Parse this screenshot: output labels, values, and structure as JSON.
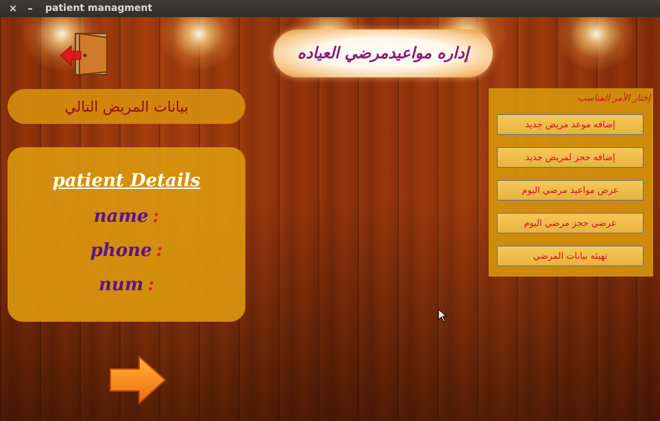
{
  "window": {
    "title": "patient managment",
    "close_glyph": "×",
    "minimize_glyph": "–"
  },
  "header": {
    "title": "إداره مواعيدمرضي العياده"
  },
  "exit": {
    "icon": "exit-door-icon"
  },
  "next_patient": {
    "label": "بيانات المريض التالي"
  },
  "details": {
    "title": "patient Details",
    "fields": [
      {
        "label": "name",
        "separator": ":"
      },
      {
        "label": "phone",
        "separator": ":"
      },
      {
        "label": "num",
        "separator": ":"
      }
    ]
  },
  "next_arrow": {
    "icon": "next-arrow-icon"
  },
  "menu": {
    "label": "إختار الأمر المناسب",
    "buttons": [
      "إضافه موعد مريض جديد",
      "إضافه حجز لمريض جديد",
      "عرض مواعيد مرضي اليوم",
      "عرضي حجز مرضي اليوم",
      "تهيئه بيانات المرضي"
    ]
  },
  "colors": {
    "accent": "#d4920c",
    "label_red": "#cc1020",
    "field_purple": "#5a148c",
    "header_text": "#8b1877"
  }
}
